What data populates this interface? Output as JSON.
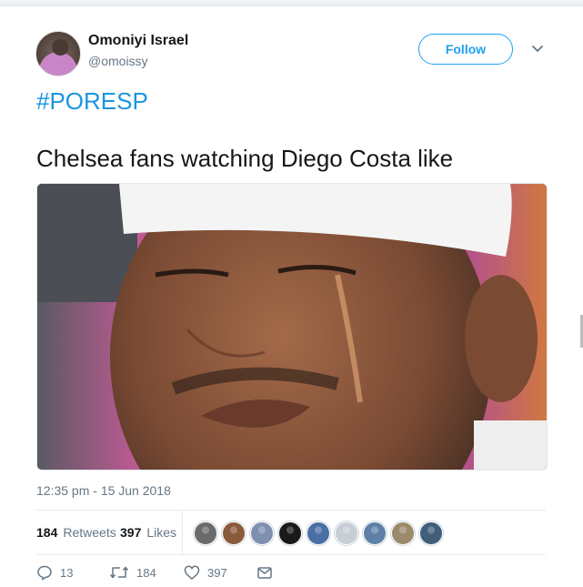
{
  "author": {
    "name": "Omoniyi Israel",
    "handle": "@omoissy"
  },
  "follow_label": "Follow",
  "hashtag": "#PORESP",
  "text": "Chelsea fans watching Diego Costa like",
  "timestamp": "12:35 pm - 15 Jun 2018",
  "stats": {
    "retweets_count": "184",
    "retweets_label": "Retweets",
    "likes_count": "397",
    "likes_label": "Likes"
  },
  "actions": {
    "replies": "13",
    "retweets": "184",
    "likes": "397"
  },
  "liker_avatars": [
    "#6b6b6b",
    "#8a5a3c",
    "#7e8fb0",
    "#1a1a1a",
    "#4a6fa5",
    "#c7ced6",
    "#5e7fa8",
    "#9a8a6a",
    "#3f5f7a"
  ],
  "colors": {
    "accent": "#1da1f2",
    "link": "#1b95e0",
    "muted": "#657786"
  }
}
